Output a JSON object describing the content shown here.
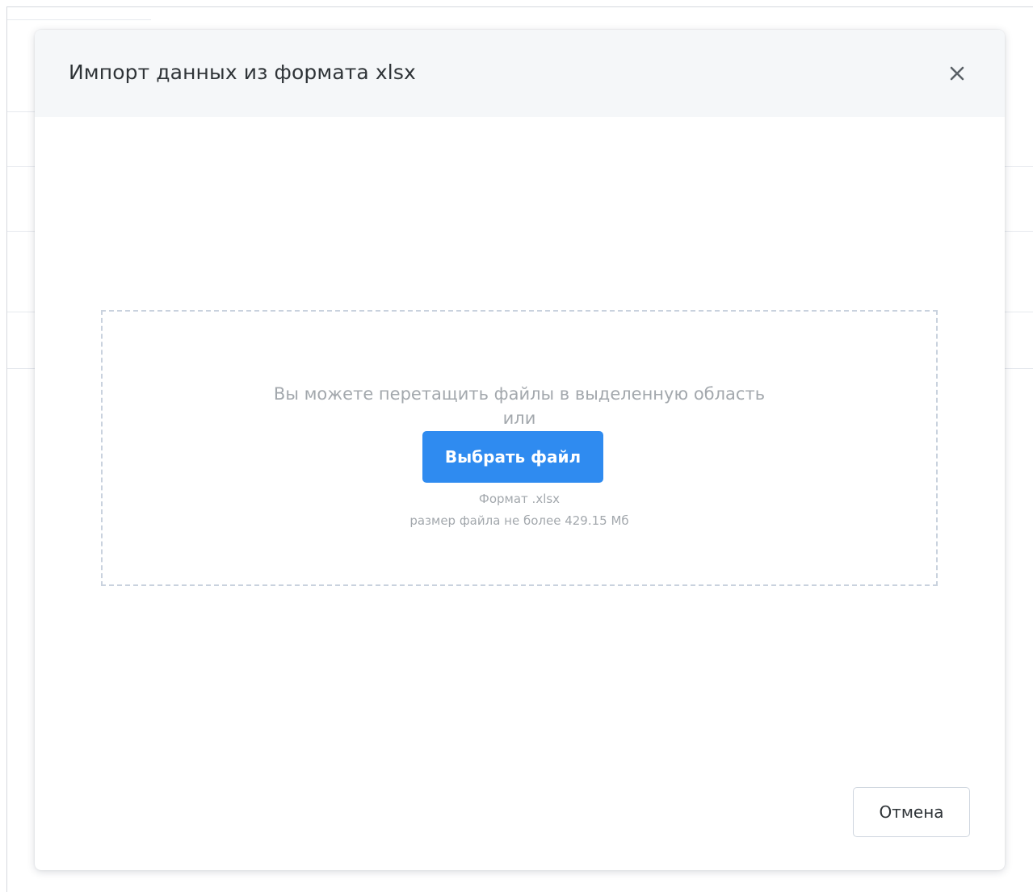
{
  "dialog": {
    "title": "Импорт данных из формата xlsx",
    "close_icon": "close-icon"
  },
  "dropzone": {
    "hint": "Вы можете перетащить файлы в выделенную область",
    "or": "или",
    "choose_button": "Выбрать файл",
    "format": "Формат .xlsx",
    "size_limit": "размер файла не более 429.15 Мб"
  },
  "footer": {
    "cancel_button": "Отмена"
  },
  "colors": {
    "accent": "#2f8bf0",
    "header_bg": "#f5f7f9",
    "dropzone_border": "#c9d2de",
    "muted_text": "#a3a8ad"
  }
}
